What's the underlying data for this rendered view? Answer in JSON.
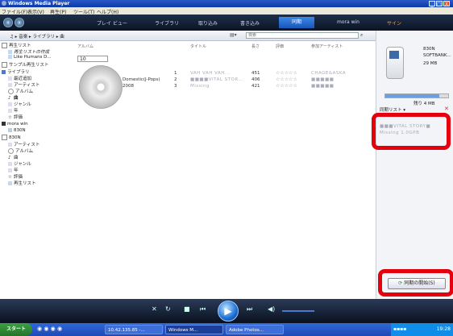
{
  "window": {
    "title": "Windows Media Player",
    "controls": [
      "_",
      "□",
      "X"
    ]
  },
  "menu": [
    "ファイル(F)",
    "表示(V)",
    "再生(P)",
    "ツール(T)",
    "ヘルプ(H)"
  ],
  "tabs": {
    "now_playing": "プレイ ビュー",
    "library": "ライブラリ",
    "rip": "取り込み",
    "burn": "書き込み",
    "sync": "同期",
    "mora": "mora win",
    "extra": "サイン"
  },
  "address": {
    "breadcrumb": "♫ ▸ 音楽 ▸ ライブラリ ▸ 曲",
    "search_placeholder": "検索"
  },
  "tree": {
    "playlists": "再生リスト",
    "create_playlist": "再生リストの作成",
    "like_humans": "Like Humans D...",
    "sample_playlist": "サンプル再生リスト",
    "library": "ライブラリ",
    "recently_added": "最近追加",
    "artist": "アーティスト",
    "album": "アルバム",
    "songs": "曲",
    "genre": "ジャンル",
    "year": "年",
    "rating": "評価",
    "mora_win": "mora win",
    "device_830n": "830N",
    "device_group": "830N",
    "d_artist": "アーティスト",
    "d_album": "アルバム",
    "d_songs": "曲",
    "d_genre": "ジャンル",
    "d_year": "年",
    "d_rating": "評価",
    "d_playlist": "再生リスト"
  },
  "columns": {
    "album": "アルバム",
    "title": "タイトル",
    "length": "長さ",
    "rating": "評価",
    "artist": "参加アーティスト"
  },
  "editing_value": "10",
  "album_info": {
    "line1": "Domestic(J-Pops)",
    "line2": "2008"
  },
  "tracks": [
    {
      "num": "1",
      "title": "VAH VAH VAH...",
      "length": "451",
      "rating": "☆☆☆☆☆",
      "artist": "CHAGE&ASKA"
    },
    {
      "num": "2",
      "title": "■■■■VITAL STOR...",
      "length": "406",
      "rating": "☆☆☆☆☆",
      "artist": "■■■■■"
    },
    {
      "num": "3",
      "title": "Missing",
      "length": "421",
      "rating": "☆☆☆☆☆",
      "artist": "■■■■■"
    }
  ],
  "sync": {
    "device_name": "830N",
    "carrier": "SOFTBANK...",
    "capacity": "29 MB",
    "free": "残り 4 MB",
    "list_label": "同期リスト ▾",
    "list_item1": "■■■VITAL STORY■",
    "list_item2": "Missing 1.0GPB",
    "start_button": "同期の開始(S)",
    "capacity_used": 0.86
  },
  "taskbar": {
    "start": "スタート",
    "tasks": [
      "10.42.135.85 -...",
      "Windows M...",
      "Adobe Photos..."
    ],
    "clock": "19:28"
  }
}
